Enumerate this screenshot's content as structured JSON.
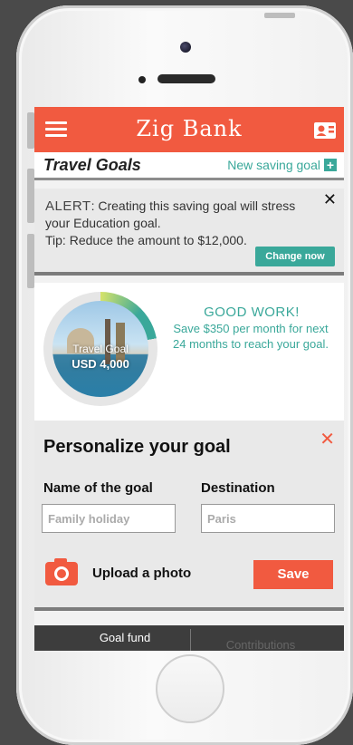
{
  "app": {
    "title": "Zig Bank",
    "accent_color": "#f15a40",
    "secondary_color": "#3aa89a"
  },
  "header": {
    "menu_icon": "hamburger-menu-icon",
    "contact_icon": "contact-card-icon"
  },
  "subheader": {
    "title": "Travel Goals",
    "new_goal_label": "New saving goal",
    "new_goal_icon": "+"
  },
  "alert": {
    "keyword": "ALERT",
    "message": ": Creating this saving goal will stress your Education goal.",
    "tip": "Tip: Reduce the amount to $12,000.",
    "close": "✕",
    "action_label": "Change now"
  },
  "goal_card": {
    "photo_label": "Travel Goal",
    "amount": "USD 4,000",
    "headline": "GOOD WORK!",
    "message": "Save $350 per month for next 24 months to reach your goal.",
    "progress_fraction": 0.22
  },
  "personalize": {
    "title": "Personalize your goal",
    "close": "✕",
    "name_label": "Name of the goal",
    "name_placeholder": "Family holiday",
    "destination_label": "Destination",
    "destination_placeholder": "Paris",
    "upload_label": "Upload a photo",
    "save_label": "Save"
  },
  "tabs": {
    "tab1": "Goal fund",
    "tab2": "Contributions"
  }
}
